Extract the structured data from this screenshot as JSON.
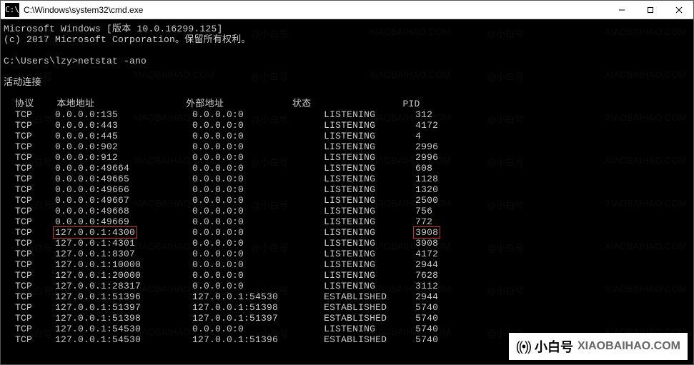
{
  "window": {
    "title": "C:\\Windows\\system32\\cmd.exe",
    "icon_label": "C:\\"
  },
  "header": {
    "line1": "Microsoft Windows [版本 10.0.16299.125]",
    "line2": "(c) 2017 Microsoft Corporation。保留所有权利。"
  },
  "prompt": {
    "path": "C:\\Users\\lzy>",
    "command": "netstat -ano"
  },
  "section_title": "活动连接",
  "columns": {
    "proto": "协议",
    "local": "本地地址",
    "foreign": "外部地址",
    "state": "状态",
    "pid": "PID"
  },
  "rows": [
    {
      "proto": "TCP",
      "local": "0.0.0.0:135",
      "foreign": "0.0.0.0:0",
      "state": "LISTENING",
      "pid": "312",
      "hl": false
    },
    {
      "proto": "TCP",
      "local": "0.0.0.0:443",
      "foreign": "0.0.0.0:0",
      "state": "LISTENING",
      "pid": "4172",
      "hl": false
    },
    {
      "proto": "TCP",
      "local": "0.0.0.0:445",
      "foreign": "0.0.0.0:0",
      "state": "LISTENING",
      "pid": "4",
      "hl": false
    },
    {
      "proto": "TCP",
      "local": "0.0.0.0:902",
      "foreign": "0.0.0.0:0",
      "state": "LISTENING",
      "pid": "2996",
      "hl": false
    },
    {
      "proto": "TCP",
      "local": "0.0.0.0:912",
      "foreign": "0.0.0.0:0",
      "state": "LISTENING",
      "pid": "2996",
      "hl": false
    },
    {
      "proto": "TCP",
      "local": "0.0.0.0:49664",
      "foreign": "0.0.0.0:0",
      "state": "LISTENING",
      "pid": "608",
      "hl": false
    },
    {
      "proto": "TCP",
      "local": "0.0.0.0:49665",
      "foreign": "0.0.0.0:0",
      "state": "LISTENING",
      "pid": "1128",
      "hl": false
    },
    {
      "proto": "TCP",
      "local": "0.0.0.0:49666",
      "foreign": "0.0.0.0:0",
      "state": "LISTENING",
      "pid": "1320",
      "hl": false
    },
    {
      "proto": "TCP",
      "local": "0.0.0.0:49667",
      "foreign": "0.0.0.0:0",
      "state": "LISTENING",
      "pid": "2500",
      "hl": false
    },
    {
      "proto": "TCP",
      "local": "0.0.0.0:49668",
      "foreign": "0.0.0.0:0",
      "state": "LISTENING",
      "pid": "756",
      "hl": false
    },
    {
      "proto": "TCP",
      "local": "0.0.0.0:49669",
      "foreign": "0.0.0.0:0",
      "state": "LISTENING",
      "pid": "772",
      "hl": false
    },
    {
      "proto": "TCP",
      "local": "127.0.0.1:4300",
      "foreign": "0.0.0.0:0",
      "state": "LISTENING",
      "pid": "3908",
      "hl": true
    },
    {
      "proto": "TCP",
      "local": "127.0.0.1:4301",
      "foreign": "0.0.0.0:0",
      "state": "LISTENING",
      "pid": "3908",
      "hl": false
    },
    {
      "proto": "TCP",
      "local": "127.0.0.1:8307",
      "foreign": "0.0.0.0:0",
      "state": "LISTENING",
      "pid": "4172",
      "hl": false
    },
    {
      "proto": "TCP",
      "local": "127.0.0.1:10000",
      "foreign": "0.0.0.0:0",
      "state": "LISTENING",
      "pid": "2944",
      "hl": false
    },
    {
      "proto": "TCP",
      "local": "127.0.0.1:20000",
      "foreign": "0.0.0.0:0",
      "state": "LISTENING",
      "pid": "7628",
      "hl": false
    },
    {
      "proto": "TCP",
      "local": "127.0.0.1:28317",
      "foreign": "0.0.0.0:0",
      "state": "LISTENING",
      "pid": "3112",
      "hl": false
    },
    {
      "proto": "TCP",
      "local": "127.0.0.1:51396",
      "foreign": "127.0.0.1:54530",
      "state": "ESTABLISHED",
      "pid": "2944",
      "hl": false
    },
    {
      "proto": "TCP",
      "local": "127.0.0.1:51397",
      "foreign": "127.0.0.1:51398",
      "state": "ESTABLISHED",
      "pid": "5740",
      "hl": false
    },
    {
      "proto": "TCP",
      "local": "127.0.0.1:51398",
      "foreign": "127.0.0.1:51397",
      "state": "ESTABLISHED",
      "pid": "5740",
      "hl": false
    },
    {
      "proto": "TCP",
      "local": "127.0.0.1:54530",
      "foreign": "0.0.0.0:0",
      "state": "LISTENING",
      "pid": "5740",
      "hl": false
    },
    {
      "proto": "TCP",
      "local": "127.0.0.1:54530",
      "foreign": "127.0.0.1:51396",
      "state": "ESTABLISHED",
      "pid": "5740",
      "hl": false
    }
  ],
  "watermark": {
    "cn": "@小白号",
    "en": "XIAOBAIHAO.COM"
  },
  "footer": {
    "icon": "((•))",
    "cn": "小白号",
    "domain": "XIAOBAIHAO.COM"
  }
}
